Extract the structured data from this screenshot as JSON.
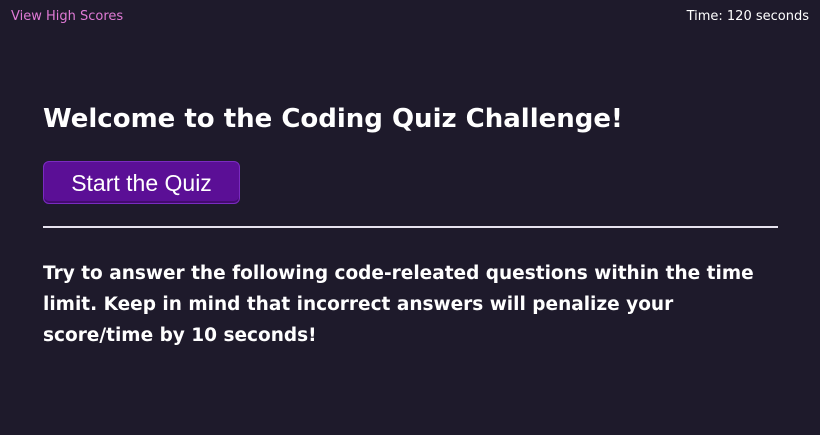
{
  "header": {
    "high_scores_link": "View High Scores",
    "timer_text": "Time: 120 seconds"
  },
  "main": {
    "title": "Welcome to the Coding Quiz Challenge!",
    "start_button_label": "Start the Quiz",
    "instructions": "Try to answer the following code-releated questions within the time limit. Keep in mind that incorrect answers will penalize your score/time by 10 seconds!"
  },
  "colors": {
    "background": "#1e1a2b",
    "link": "#e07ad6",
    "button": "#5b0f96",
    "text": "#ffffff"
  }
}
